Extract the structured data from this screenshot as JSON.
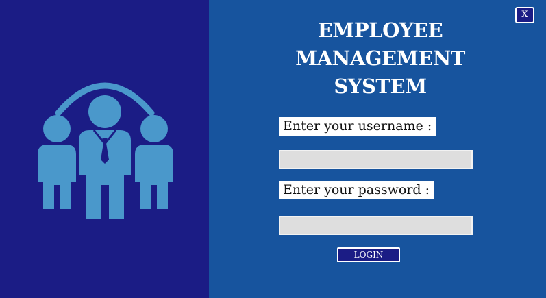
{
  "window": {
    "close_label": "X",
    "illustration_icon": "employee-group-icon"
  },
  "header": {
    "title_lines": [
      "EMPLOYEE",
      "MANAGEMENT",
      "SYSTEM"
    ]
  },
  "form": {
    "username_label": "Enter your username :",
    "username_value": "",
    "password_label": "Enter your password :",
    "password_value": "",
    "login_label": "LOGIN"
  },
  "colors": {
    "left_panel": "#1b1c85",
    "right_panel": "#17549e",
    "illustration": "#4a98cb",
    "input_background": "#dedede"
  }
}
